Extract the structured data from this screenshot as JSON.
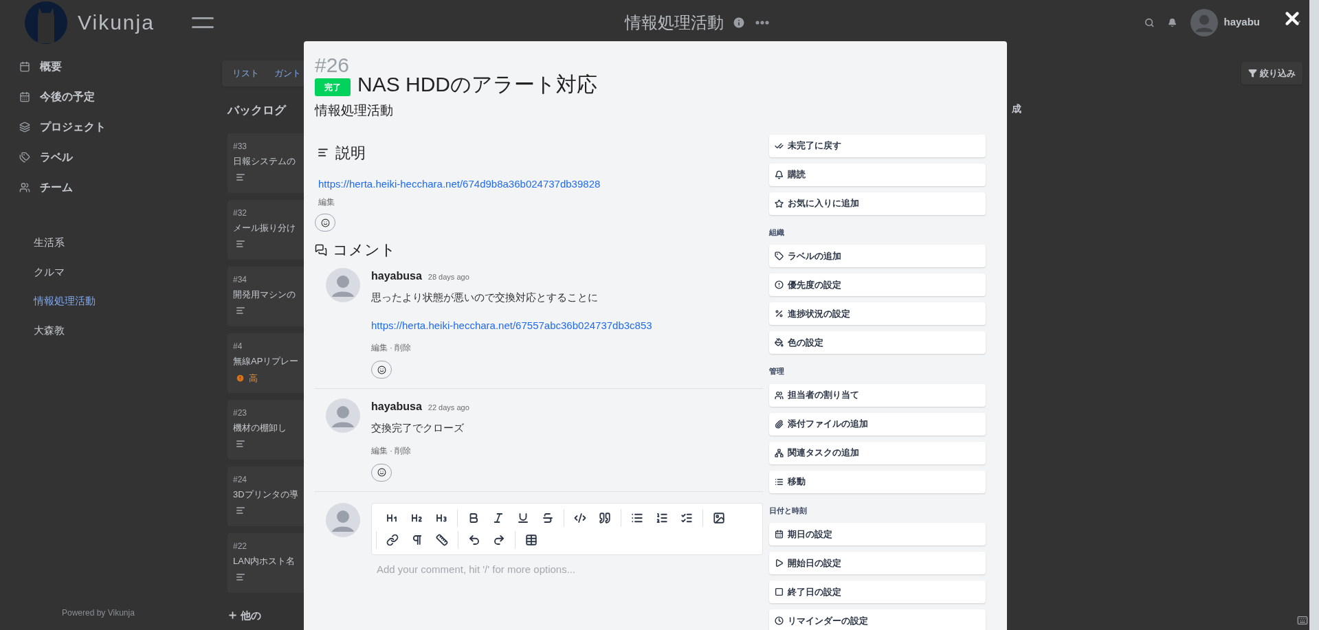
{
  "app": {
    "logo_text": "Vikunja",
    "user_name": "hayabu"
  },
  "header": {
    "title": "情報処理活動"
  },
  "sidebar": {
    "nav": [
      {
        "label": "概要"
      },
      {
        "label": "今後の予定"
      },
      {
        "label": "プロジェクト"
      },
      {
        "label": "ラベル"
      },
      {
        "label": "チーム"
      }
    ],
    "projects": [
      {
        "label": "生活系",
        "selected": false
      },
      {
        "label": "クルマ",
        "selected": false
      },
      {
        "label": "情報処理活動",
        "selected": true
      },
      {
        "label": "大森教",
        "selected": false
      }
    ],
    "footer": "Powered by Vikunja"
  },
  "view_tabs": [
    {
      "label": "リスト"
    },
    {
      "label": "ガント"
    }
  ],
  "filter_button": "絞り込み",
  "bucket": {
    "title": "バックログ",
    "cards": [
      {
        "id": "#33",
        "title": "日報システムの",
        "kind": "description"
      },
      {
        "id": "#32",
        "title": "メール振り分け",
        "kind": "description"
      },
      {
        "id": "#34",
        "title": "開発用マシンの",
        "kind": "description"
      },
      {
        "id": "#4",
        "title": "無線APリプレー",
        "kind": "priority",
        "priority": "高"
      },
      {
        "id": "#23",
        "title": "機材の棚卸し",
        "kind": "description"
      },
      {
        "id": "#24",
        "title": "3Dプリンタの導",
        "kind": "description"
      },
      {
        "id": "#22",
        "title": "LAN内ホスト名",
        "kind": "description"
      }
    ],
    "add_more": "他の"
  },
  "column_2_fragment": "成",
  "task": {
    "number": "#26",
    "done": true,
    "done_label": "完了",
    "title": "NAS HDDのアラート対応",
    "project": "情報処理活動",
    "description_heading": "説明",
    "description_link": "https://herta.heiki-hecchara.net/674d9b8a36b024737db39828",
    "description_edit": "編集",
    "comments_heading": "コメント",
    "comments": [
      {
        "author": "hayabusa",
        "time": "28 days ago",
        "paragraphs": [
          {
            "kind": "text",
            "text": "思ったより状態が悪いので交換対応とすることに"
          },
          {
            "kind": "link",
            "text": "https://herta.heiki-hecchara.net/67557abc36b024737db3c853"
          }
        ],
        "actions": [
          "編集",
          "削除"
        ],
        "action_separator": "·"
      },
      {
        "author": "hayabusa",
        "time": "22 days ago",
        "paragraphs": [
          {
            "kind": "text",
            "text": "交換完了でクローズ"
          }
        ],
        "actions": [
          "編集",
          "削除"
        ],
        "action_separator": "·"
      }
    ],
    "editor_placeholder": "Add your comment, hit '/' for more options..."
  },
  "actions": {
    "top": [
      "未完了に戻す",
      "購読",
      "お気に入りに追加"
    ],
    "sections": [
      {
        "title": "組織",
        "buttons": [
          "ラベルの追加",
          "優先度の設定",
          "進捗状況の設定",
          "色の設定"
        ]
      },
      {
        "title": "管理",
        "buttons": [
          "担当者の割り当て",
          "添付ファイルの追加",
          "関連タスクの追加",
          "移動"
        ]
      },
      {
        "title": "日付と時刻",
        "buttons": [
          "期日の設定",
          "開始日の設定",
          "終了日の設定",
          "リマインダーの設定"
        ]
      }
    ]
  }
}
